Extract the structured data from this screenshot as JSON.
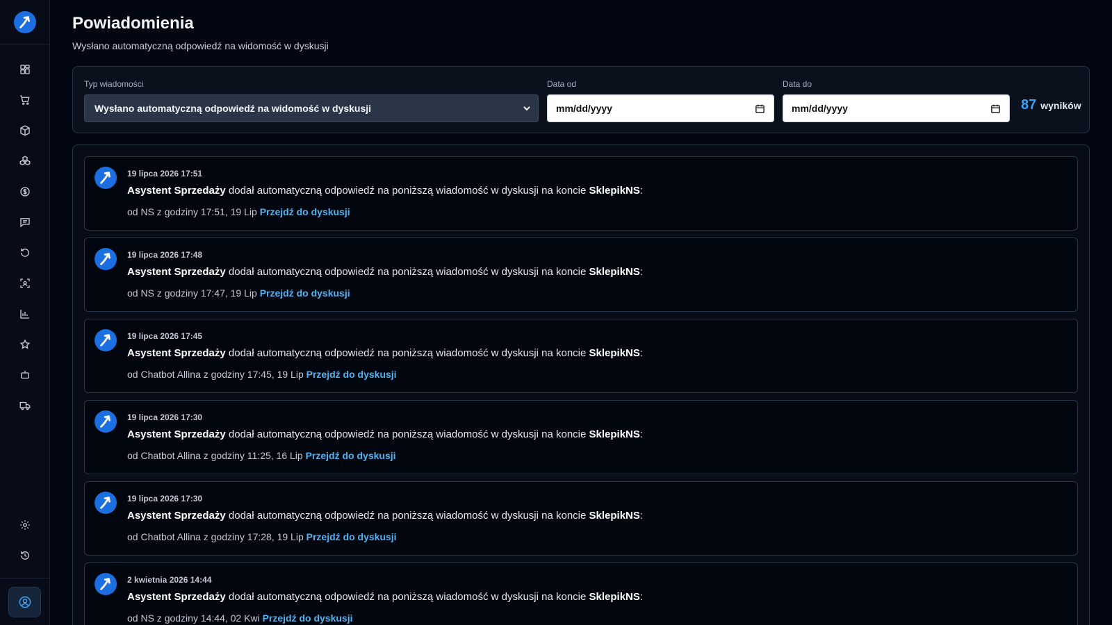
{
  "colors": {
    "accent": "#3aa2f5",
    "link": "#52b3f2",
    "brand": "#1b6fe0"
  },
  "page": {
    "title": "Powiadomienia",
    "subtitle": "Wysłano automatyczną odpowiedź na widomość w dyskusji"
  },
  "filters": {
    "type_label": "Typ wiadomości",
    "type_value": "Wysłano automatyczną odpowiedź na widomość w dyskusji",
    "date_from_label": "Data od",
    "date_from_value": "mm/dd/yyyy",
    "date_to_label": "Data do",
    "date_to_value": "mm/dd/yyyy",
    "count": "87",
    "count_label": "wyników"
  },
  "sidebar": {
    "icons": [
      "dashboard-icon",
      "cart-icon",
      "package-icon",
      "boxes-icon",
      "dollar-icon",
      "chat-icon",
      "refresh-icon",
      "scan-icon",
      "chart-icon",
      "star-icon",
      "robot-icon",
      "truck-icon"
    ],
    "bottom_icons": [
      "gear-icon",
      "history-icon"
    ],
    "profile_icon": "user-circle-icon"
  },
  "notifications": [
    {
      "date": "19 lipca 2026 17:51",
      "actor": "Asystent Sprzedaży",
      "text": " dodał automatyczną odpowiedź na poniższą wiadomość w dyskusji na koncie ",
      "account": "SklepikNS",
      "colon": ":",
      "from": "od NS z godziny 17:51, 19 Lip ",
      "link": "Przejdź do dyskusji"
    },
    {
      "date": "19 lipca 2026 17:48",
      "actor": "Asystent Sprzedaży",
      "text": " dodał automatyczną odpowiedź na poniższą wiadomość w dyskusji na koncie ",
      "account": "SklepikNS",
      "colon": ":",
      "from": "od NS z godziny 17:47, 19 Lip ",
      "link": "Przejdź do dyskusji"
    },
    {
      "date": "19 lipca 2026 17:45",
      "actor": "Asystent Sprzedaży",
      "text": " dodał automatyczną odpowiedź na poniższą wiadomość w dyskusji na koncie ",
      "account": "SklepikNS",
      "colon": ":",
      "from": "od Chatbot Allina z godziny 17:45, 19 Lip ",
      "link": "Przejdź do dyskusji"
    },
    {
      "date": "19 lipca 2026 17:30",
      "actor": "Asystent Sprzedaży",
      "text": " dodał automatyczną odpowiedź na poniższą wiadomość w dyskusji na koncie ",
      "account": "SklepikNS",
      "colon": ":",
      "from": "od Chatbot Allina z godziny 11:25, 16 Lip ",
      "link": "Przejdź do dyskusji"
    },
    {
      "date": "19 lipca 2026 17:30",
      "actor": "Asystent Sprzedaży",
      "text": " dodał automatyczną odpowiedź na poniższą wiadomość w dyskusji na koncie ",
      "account": "SklepikNS",
      "colon": ":",
      "from": "od Chatbot Allina z godziny 17:28, 19 Lip ",
      "link": "Przejdź do dyskusji"
    },
    {
      "date": "2 kwietnia 2026 14:44",
      "actor": "Asystent Sprzedaży",
      "text": " dodał automatyczną odpowiedź na poniższą wiadomość w dyskusji na koncie ",
      "account": "SklepikNS",
      "colon": ":",
      "from": "od NS z godziny 14:44, 02 Kwi ",
      "link": "Przejdź do dyskusji"
    }
  ]
}
